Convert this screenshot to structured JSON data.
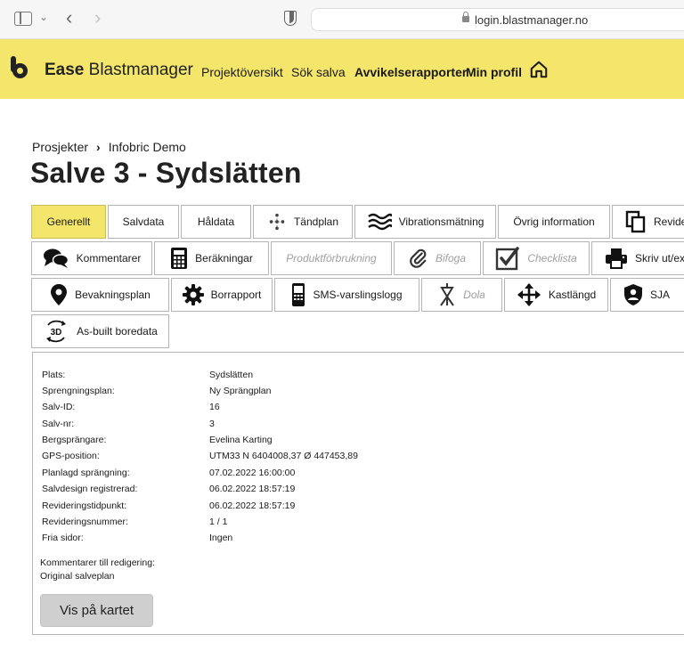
{
  "browser": {
    "url": "login.blastmanager.no"
  },
  "header": {
    "brand_part1": "Ease",
    "brand_part2": "Blastmanager",
    "nav": [
      {
        "label": "Projektöversikt"
      },
      {
        "label": "Sök salva"
      },
      {
        "label": "Avvikelserapporter"
      },
      {
        "label": "Min profil"
      }
    ]
  },
  "breadcrumb": {
    "root": "Prosjekter",
    "separator": "›",
    "current": "Infobric Demo"
  },
  "page_title": "Salve 3 - Sydslätten",
  "tabs": [
    {
      "label": "Generellt",
      "active": true,
      "icon": "none"
    },
    {
      "label": "Salvdata",
      "icon": "none"
    },
    {
      "label": "Håldata",
      "icon": "none"
    },
    {
      "label": "Tändplan",
      "icon": "tandplan-icon"
    },
    {
      "label": "Vibrationsmätning",
      "icon": "waves-icon"
    },
    {
      "label": "Övrig information",
      "icon": "none"
    },
    {
      "label": "Revide",
      "icon": "copy-icon"
    },
    {
      "label": "Kommentarer",
      "icon": "chat-icon"
    },
    {
      "label": "Beräkningar",
      "icon": "calculator-icon"
    },
    {
      "label": "Produktförbrukning",
      "disabled": true,
      "icon": "none"
    },
    {
      "label": "Bifoga",
      "disabled": true,
      "icon": "paperclip-icon"
    },
    {
      "label": "Checklista",
      "disabled": true,
      "icon": "checkbox-icon"
    },
    {
      "label": "Skriv ut/exp",
      "icon": "printer-icon"
    },
    {
      "label": "Bevakningsplan",
      "icon": "map-pin-icon"
    },
    {
      "label": "Borrapport",
      "icon": "gear-icon"
    },
    {
      "label": "SMS-varslingslogg",
      "icon": "phone-icon"
    },
    {
      "label": "Dola",
      "disabled": true,
      "icon": "dola-icon"
    },
    {
      "label": "Kastlängd",
      "icon": "move-arrows-icon"
    },
    {
      "label": "SJA",
      "icon": "shield-person-icon"
    },
    {
      "label": "As-built boredata",
      "icon": "rotate-3d-icon"
    }
  ],
  "icons": {
    "badge_3d": "3D"
  },
  "details": [
    {
      "label": "Plats:",
      "value": "Sydslätten"
    },
    {
      "label": "Sprengningsplan:",
      "value": "Ny Sprängplan"
    },
    {
      "label": "Salv-ID:",
      "value": "16"
    },
    {
      "label": "Salv-nr:",
      "value": "3"
    },
    {
      "label": "Bergsprängare:",
      "value": "Evelina Karting"
    },
    {
      "label": "GPS-position:",
      "value": "UTM33 N 6404008,37 Ø 447453,89"
    },
    {
      "label": "Planlagd sprängning:",
      "value": "07.02.2022 16:00:00"
    },
    {
      "label": "Salvdesign registrerad:",
      "value": "06.02.2022 18:57:19"
    },
    {
      "label": "Revideringstidpunkt:",
      "value": "06.02.2022 18:57:19"
    },
    {
      "label": "Revideringsnummer:",
      "value": "1 / 1"
    },
    {
      "label": "Fria sidor:",
      "value": "Ingen"
    }
  ],
  "comments": {
    "label": "Kommentarer till redigering:",
    "value": "Original salveplan"
  },
  "map_button_label": "Vis på kartet",
  "colors": {
    "header_bg": "#f4e56b",
    "active_tab": "#f4e56b",
    "disabled_text": "#a0a0a0"
  }
}
